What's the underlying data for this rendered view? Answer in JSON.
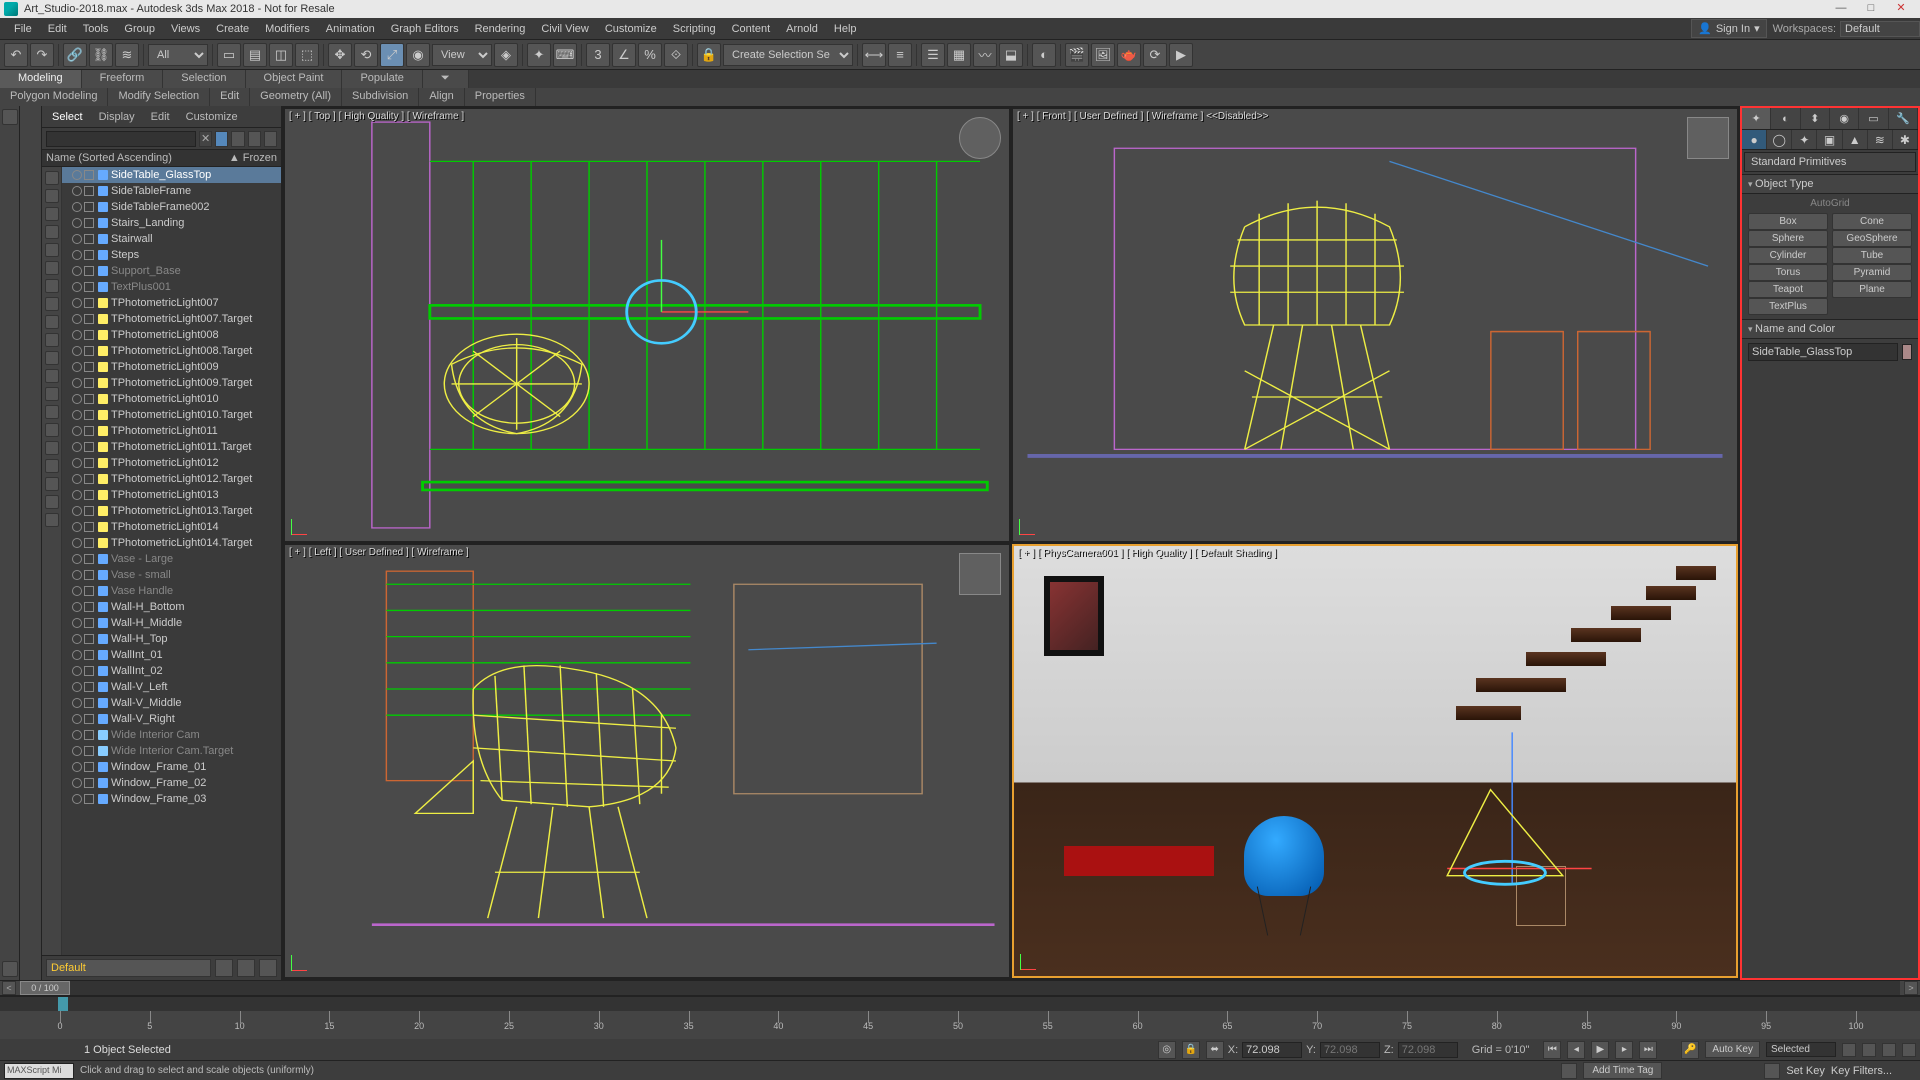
{
  "title": "Art_Studio-2018.max - Autodesk 3ds Max 2018 - Not for Resale",
  "menus": [
    "File",
    "Edit",
    "Tools",
    "Group",
    "Views",
    "Create",
    "Modifiers",
    "Animation",
    "Graph Editors",
    "Rendering",
    "Civil View",
    "Customize",
    "Scripting",
    "Content",
    "Arnold",
    "Help"
  ],
  "signin": "Sign In",
  "workspace_label": "Workspaces:",
  "workspace_value": "Default",
  "toolbar_filter": "All",
  "toolbar_view": "View",
  "toolbar_selset": "Create Selection Se",
  "ribbon_tabs": [
    "Modeling",
    "Freeform",
    "Selection",
    "Object Paint",
    "Populate"
  ],
  "ribbon_sub": [
    "Polygon Modeling",
    "Modify Selection",
    "Edit",
    "Geometry (All)",
    "Subdivision",
    "Align",
    "Properties"
  ],
  "scene_explorer": {
    "tabs": [
      "Select",
      "Display",
      "Edit",
      "Customize"
    ],
    "columns": {
      "name": "Name (Sorted Ascending)",
      "frozen": "▲ Frozen"
    },
    "items": [
      {
        "label": "SideTable_GlassTop",
        "sel": true
      },
      {
        "label": "SideTableFrame"
      },
      {
        "label": "SideTableFrame002"
      },
      {
        "label": "Stairs_Landing"
      },
      {
        "label": "Stairwall"
      },
      {
        "label": "Steps"
      },
      {
        "label": "Support_Base",
        "dim": true
      },
      {
        "label": "TextPlus001",
        "dim": true
      },
      {
        "label": "TPhotometricLight007",
        "light": true
      },
      {
        "label": "TPhotometricLight007.Target",
        "light": true
      },
      {
        "label": "TPhotometricLight008",
        "light": true
      },
      {
        "label": "TPhotometricLight008.Target",
        "light": true
      },
      {
        "label": "TPhotometricLight009",
        "light": true
      },
      {
        "label": "TPhotometricLight009.Target",
        "light": true
      },
      {
        "label": "TPhotometricLight010",
        "light": true
      },
      {
        "label": "TPhotometricLight010.Target",
        "light": true
      },
      {
        "label": "TPhotometricLight011",
        "light": true
      },
      {
        "label": "TPhotometricLight011.Target",
        "light": true
      },
      {
        "label": "TPhotometricLight012",
        "light": true
      },
      {
        "label": "TPhotometricLight012.Target",
        "light": true
      },
      {
        "label": "TPhotometricLight013",
        "light": true
      },
      {
        "label": "TPhotometricLight013.Target",
        "light": true
      },
      {
        "label": "TPhotometricLight014",
        "light": true
      },
      {
        "label": "TPhotometricLight014.Target",
        "light": true
      },
      {
        "label": "Vase - Large",
        "dim": true
      },
      {
        "label": "Vase - small",
        "dim": true
      },
      {
        "label": "Vase Handle",
        "dim": true
      },
      {
        "label": "Wall-H_Bottom"
      },
      {
        "label": "Wall-H_Middle"
      },
      {
        "label": "Wall-H_Top"
      },
      {
        "label": "WallInt_01"
      },
      {
        "label": "WallInt_02"
      },
      {
        "label": "Wall-V_Left"
      },
      {
        "label": "Wall-V_Middle"
      },
      {
        "label": "Wall-V_Right"
      },
      {
        "label": "Wide Interior Cam",
        "dim": true,
        "cam": true
      },
      {
        "label": "Wide Interior Cam.Target",
        "dim": true,
        "cam": true
      },
      {
        "label": "Window_Frame_01"
      },
      {
        "label": "Window_Frame_02"
      },
      {
        "label": "Window_Frame_03"
      }
    ],
    "layer": "Default"
  },
  "timeslider": "0 / 100",
  "viewports": {
    "top": "[ + ] [ Top ] [ High Quality ] [ Wireframe ]",
    "front": "[ + ] [ Front ] [ User Defined ] [ Wireframe ]   <<Disabled>>",
    "left": "[ + ] [ Left ] [ User Defined ] [ Wireframe ]",
    "camera": "[ + ] [ PhysCamera001 ] [ High Quality ] [ Default Shading ]"
  },
  "command_panel": {
    "category": "Standard Primitives",
    "rollout_objtype": "Object Type",
    "autogrid": "AutoGrid",
    "prims": [
      [
        "Box",
        "Cone"
      ],
      [
        "Sphere",
        "GeoSphere"
      ],
      [
        "Cylinder",
        "Tube"
      ],
      [
        "Torus",
        "Pyramid"
      ],
      [
        "Teapot",
        "Plane"
      ],
      [
        "TextPlus",
        ""
      ]
    ],
    "rollout_name": "Name and Color",
    "name_value": "SideTable_GlassTop"
  },
  "ruler_ticks": [
    0,
    5,
    10,
    15,
    20,
    25,
    30,
    35,
    40,
    45,
    50,
    55,
    60,
    65,
    70,
    75,
    80,
    85,
    90,
    95,
    100
  ],
  "status": {
    "selection": "1 Object Selected",
    "prompt": "Click and drag to select and scale objects (uniformly)",
    "x_lbl": "X:",
    "x": "72.098",
    "y_lbl": "Y:",
    "y": "72.098",
    "z_lbl": "Z:",
    "z": "72.098",
    "grid": "Grid = 0'10\"",
    "autokey": "Auto Key",
    "setkey": "Set Key",
    "selected": "Selected",
    "keyfilters": "Key Filters...",
    "addtag": "Add Time Tag",
    "script": "MAXScript Mi"
  }
}
